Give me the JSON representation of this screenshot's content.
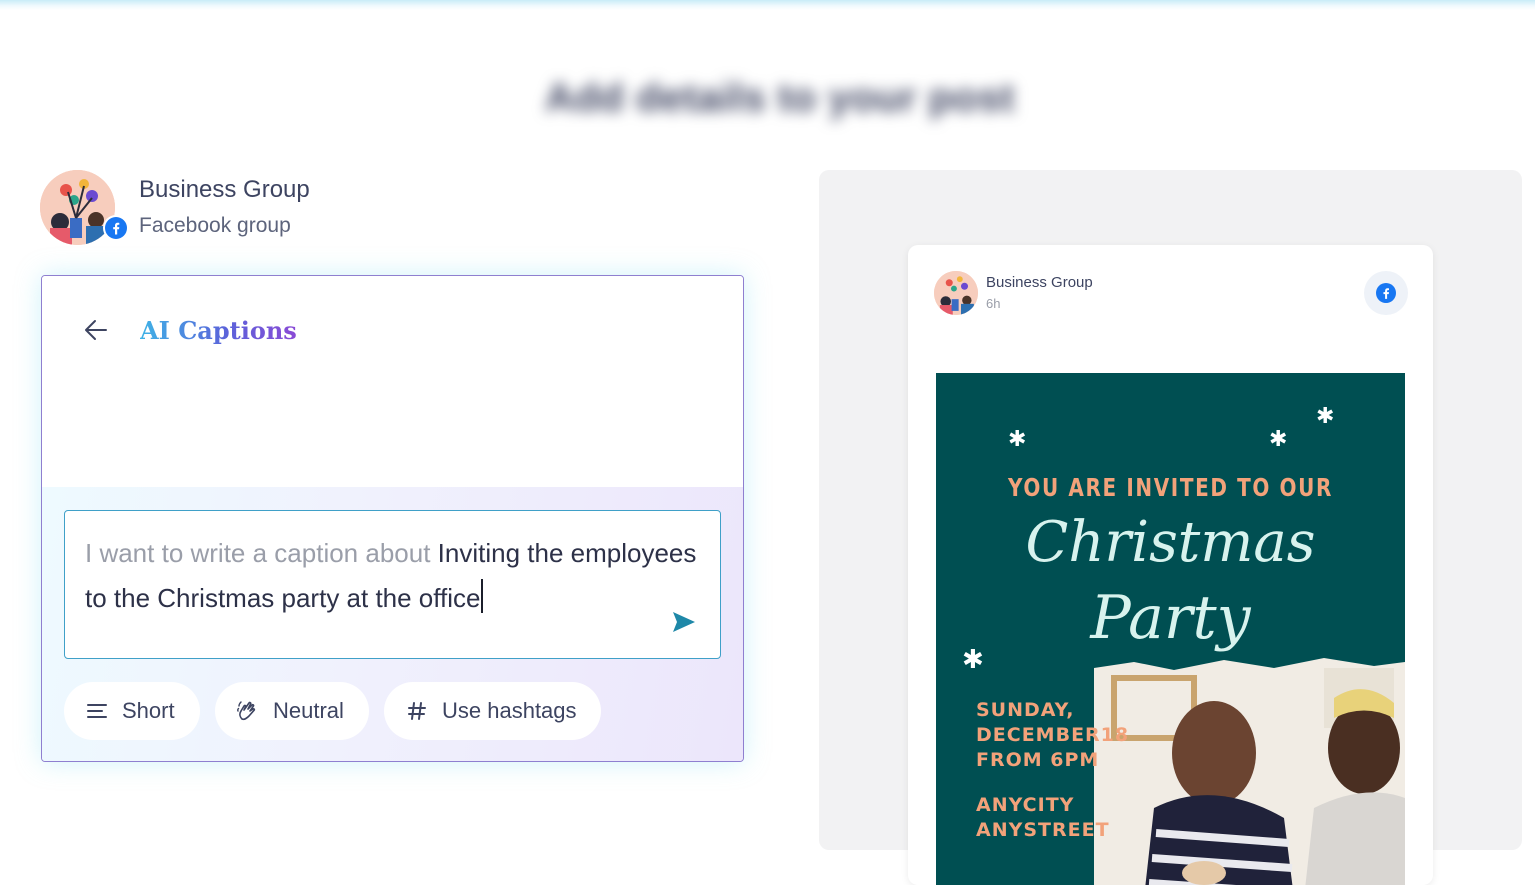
{
  "page": {
    "title": "Add details to your post"
  },
  "account": {
    "name": "Business Group",
    "type": "Facebook group"
  },
  "ai_captions": {
    "title": "AI Captions",
    "prompt_prefix": "I want to write a caption about ",
    "prompt_value": "Inviting the employees to the Christmas party at the office",
    "chips": [
      {
        "label": "Short",
        "icon": "lines-icon"
      },
      {
        "label": "Neutral",
        "icon": "hand-wave-icon"
      },
      {
        "label": "Use hashtags",
        "icon": "hashtag-icon"
      }
    ]
  },
  "preview": {
    "author": "Business Group",
    "time": "6h",
    "image": {
      "invite_line": "YOU ARE INVITED TO OUR",
      "title_line1": "Christmas",
      "title_line2": "Party",
      "details_day": "SUNDAY,",
      "details_date": "DECEMBER18",
      "details_time": "FROM 6PM",
      "location_line1": "ANYCITY",
      "location_line2": "ANYSTREET"
    }
  },
  "colors": {
    "accent": "#3fa0c8",
    "send": "#1e88a8",
    "facebook": "#1877f2",
    "poster_bg": "#004f52",
    "poster_accent": "#f2a27a"
  }
}
